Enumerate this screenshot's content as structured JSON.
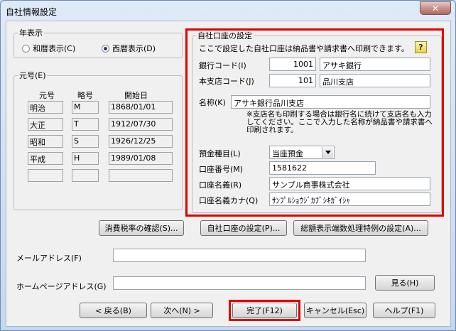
{
  "window": {
    "title": "自社情報設定",
    "close_glyph": "✕"
  },
  "era_display": {
    "legend": "年表示",
    "option_wareki": "和暦表示(C)",
    "option_seireki": "西暦表示(D)",
    "selected": "西暦表示(D)"
  },
  "gengo": {
    "legend": "元号(E)",
    "col_era": "元号",
    "col_abbr": "略号",
    "col_start": "開始日",
    "rows": [
      {
        "era": "明治",
        "abbr": "M",
        "start": "1868/01/01"
      },
      {
        "era": "大正",
        "abbr": "T",
        "start": "1912/07/30"
      },
      {
        "era": "昭和",
        "abbr": "S",
        "start": "1926/12/25"
      },
      {
        "era": "平成",
        "abbr": "H",
        "start": "1989/01/08"
      },
      {
        "era": "",
        "abbr": "",
        "start": ""
      }
    ]
  },
  "bank": {
    "legend": "自社口座の設定",
    "intro": "ここで設定した自社口座は納品書や請求書へ印刷できます。",
    "bank_code_label": "銀行コード(I)",
    "bank_code": "1001",
    "bank_name": "アサキ銀行",
    "branch_code_label": "本支店コード(J)",
    "branch_code": "101",
    "branch_name": "品川支店",
    "name_label": "名称(K)",
    "name_value": "アサキ銀行品川支店",
    "note": "※支店名も印刷する場合は銀行名に続けて支店名も入力してください。ここで入力した名称が納品書や請求書へ印刷されます。",
    "deposit_type_label": "預金種目(L)",
    "deposit_type": "当座預金",
    "account_no_label": "口座番号(M)",
    "account_no": "1581622",
    "account_holder_label": "口座名義(R)",
    "account_holder": "サンプル商事株式会社",
    "account_kana_label": "口座名義カナ(Q)",
    "account_kana": "ｻﾝﾌﾟﾙｼｮｳｼﾞｶﾌﾞｼｷｶﾞｲｼｬ"
  },
  "mid_buttons": {
    "tax_check": "消費税率の確認(S)...",
    "bank_setting": "自社口座の設定(P)...",
    "total_rounding": "総額表示端数処理特例の設定(A)..."
  },
  "contact": {
    "email_label": "メールアドレス(F)",
    "email_value": "",
    "homepage_label": "ホームページアドレス(G)",
    "homepage_value": "",
    "view_button": "見る(H)"
  },
  "footer": {
    "back": "< 戻る(B)",
    "next": "次へ(N) >",
    "finish": "完了(F12)",
    "cancel": "キャンセル(Esc)",
    "help": "ヘルプ(F1)"
  },
  "colors": {
    "highlight": "#e00000"
  }
}
